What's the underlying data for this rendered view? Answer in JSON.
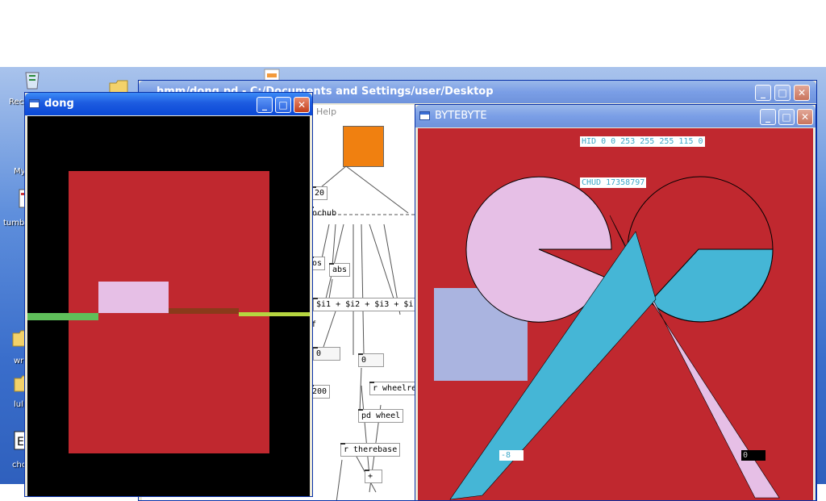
{
  "desktop": {
    "labels": [
      "Rec",
      "My",
      "tumbl",
      "wr",
      "lul",
      "cho"
    ]
  },
  "pd_window": {
    "title": "hmm/dong.pd - C:/Documents and Settings/user/Desktop",
    "menu_help": "Help",
    "boxes": [
      "20",
      "ochub",
      "os",
      "abs",
      "$i1 + $i2 + $i3 + $i",
      "f",
      "0",
      "0",
      "200",
      "r wheelres",
      "pd wheel",
      "r therebase",
      "+"
    ]
  },
  "dong_window": {
    "title": "dong"
  },
  "bytebyte_window": {
    "title": "BYTEBYTE",
    "hid_readout": "HID 0 0 253 255 255 115 0",
    "chud_readout": "CHUD 17358797",
    "small_readout": "-8",
    "dark_readout": "0"
  },
  "colors": {
    "red_field": "#c0282f",
    "pink": "#e6bfe6",
    "cyan": "#45b6d6",
    "lavender": "#aab4e0",
    "orange": "#f08010"
  }
}
